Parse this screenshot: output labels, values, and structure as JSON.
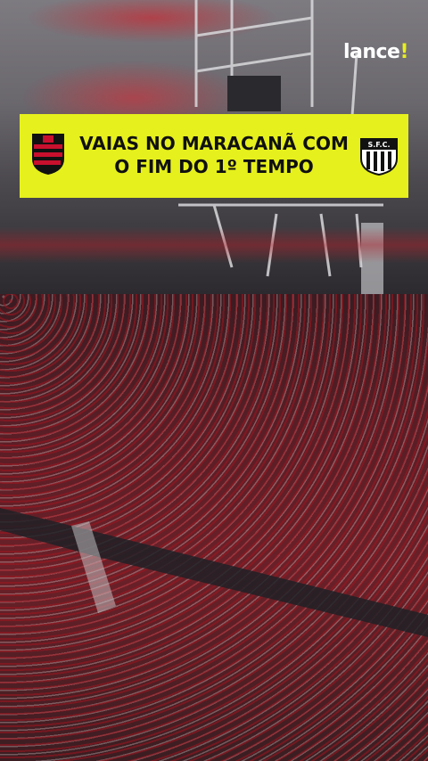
{
  "brand": {
    "name": "lance",
    "mark": "!"
  },
  "headline": {
    "line1": "VAIAS NO MARACANÃ COM",
    "line2": "O FIM DO 1º TEMPO"
  },
  "right_crest": {
    "initials": "S.F.C."
  },
  "colors": {
    "banner": "#e6f01c",
    "home_red": "#c8102e",
    "home_black": "#111111"
  }
}
